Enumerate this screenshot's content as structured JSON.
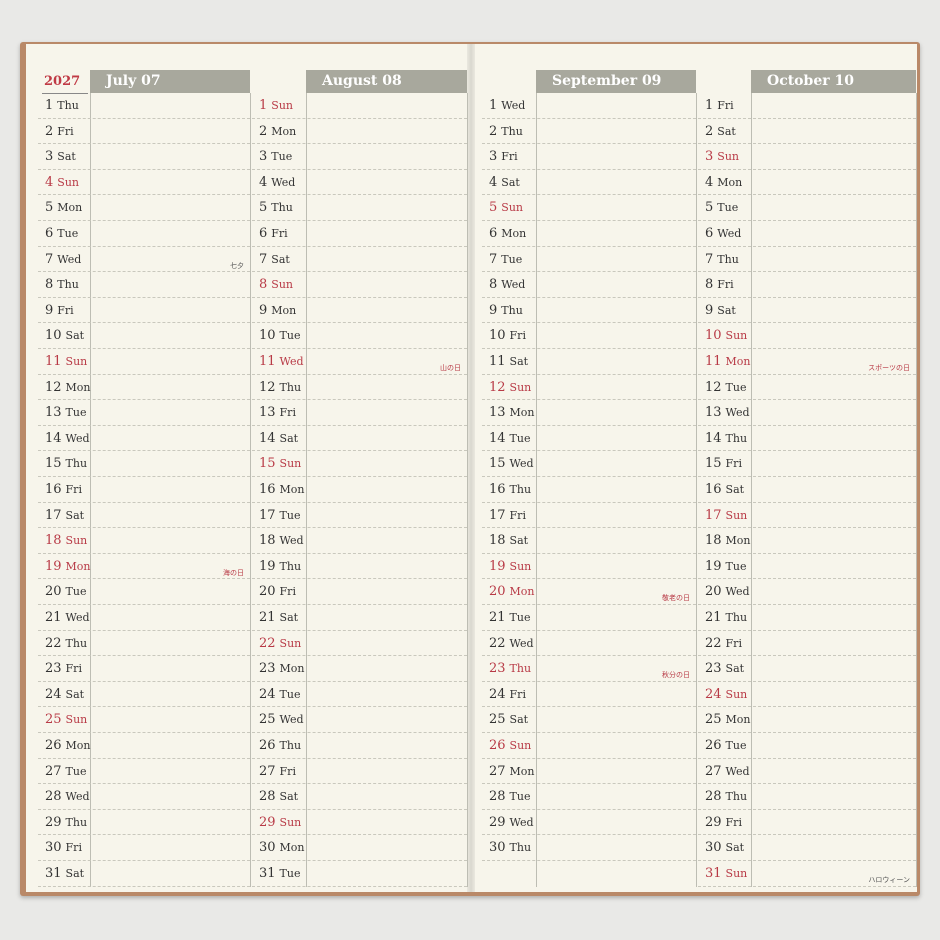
{
  "year": "2027",
  "columns": [
    {
      "month_label": "July 07",
      "days": [
        {
          "n": "1",
          "w": "Thu"
        },
        {
          "n": "2",
          "w": "Fri"
        },
        {
          "n": "3",
          "w": "Sat"
        },
        {
          "n": "4",
          "w": "Sun",
          "red": true
        },
        {
          "n": "5",
          "w": "Mon"
        },
        {
          "n": "6",
          "w": "Tue"
        },
        {
          "n": "7",
          "w": "Wed",
          "hol": "七夕",
          "hol_black": true
        },
        {
          "n": "8",
          "w": "Thu"
        },
        {
          "n": "9",
          "w": "Fri"
        },
        {
          "n": "10",
          "w": "Sat"
        },
        {
          "n": "11",
          "w": "Sun",
          "red": true
        },
        {
          "n": "12",
          "w": "Mon"
        },
        {
          "n": "13",
          "w": "Tue"
        },
        {
          "n": "14",
          "w": "Wed"
        },
        {
          "n": "15",
          "w": "Thu"
        },
        {
          "n": "16",
          "w": "Fri"
        },
        {
          "n": "17",
          "w": "Sat"
        },
        {
          "n": "18",
          "w": "Sun",
          "red": true
        },
        {
          "n": "19",
          "w": "Mon",
          "red": true,
          "hol": "海の日"
        },
        {
          "n": "20",
          "w": "Tue"
        },
        {
          "n": "21",
          "w": "Wed"
        },
        {
          "n": "22",
          "w": "Thu"
        },
        {
          "n": "23",
          "w": "Fri"
        },
        {
          "n": "24",
          "w": "Sat"
        },
        {
          "n": "25",
          "w": "Sun",
          "red": true
        },
        {
          "n": "26",
          "w": "Mon"
        },
        {
          "n": "27",
          "w": "Tue"
        },
        {
          "n": "28",
          "w": "Wed"
        },
        {
          "n": "29",
          "w": "Thu"
        },
        {
          "n": "30",
          "w": "Fri"
        },
        {
          "n": "31",
          "w": "Sat"
        }
      ]
    },
    {
      "month_label": "August 08",
      "days": [
        {
          "n": "1",
          "w": "Sun",
          "red": true
        },
        {
          "n": "2",
          "w": "Mon"
        },
        {
          "n": "3",
          "w": "Tue"
        },
        {
          "n": "4",
          "w": "Wed"
        },
        {
          "n": "5",
          "w": "Thu"
        },
        {
          "n": "6",
          "w": "Fri"
        },
        {
          "n": "7",
          "w": "Sat"
        },
        {
          "n": "8",
          "w": "Sun",
          "red": true
        },
        {
          "n": "9",
          "w": "Mon"
        },
        {
          "n": "10",
          "w": "Tue"
        },
        {
          "n": "11",
          "w": "Wed",
          "red": true,
          "hol": "山の日"
        },
        {
          "n": "12",
          "w": "Thu"
        },
        {
          "n": "13",
          "w": "Fri"
        },
        {
          "n": "14",
          "w": "Sat"
        },
        {
          "n": "15",
          "w": "Sun",
          "red": true
        },
        {
          "n": "16",
          "w": "Mon"
        },
        {
          "n": "17",
          "w": "Tue"
        },
        {
          "n": "18",
          "w": "Wed"
        },
        {
          "n": "19",
          "w": "Thu"
        },
        {
          "n": "20",
          "w": "Fri"
        },
        {
          "n": "21",
          "w": "Sat"
        },
        {
          "n": "22",
          "w": "Sun",
          "red": true
        },
        {
          "n": "23",
          "w": "Mon"
        },
        {
          "n": "24",
          "w": "Tue"
        },
        {
          "n": "25",
          "w": "Wed"
        },
        {
          "n": "26",
          "w": "Thu"
        },
        {
          "n": "27",
          "w": "Fri"
        },
        {
          "n": "28",
          "w": "Sat"
        },
        {
          "n": "29",
          "w": "Sun",
          "red": true
        },
        {
          "n": "30",
          "w": "Mon"
        },
        {
          "n": "31",
          "w": "Tue"
        }
      ]
    },
    {
      "month_label": "September 09",
      "days": [
        {
          "n": "1",
          "w": "Wed"
        },
        {
          "n": "2",
          "w": "Thu"
        },
        {
          "n": "3",
          "w": "Fri"
        },
        {
          "n": "4",
          "w": "Sat"
        },
        {
          "n": "5",
          "w": "Sun",
          "red": true
        },
        {
          "n": "6",
          "w": "Mon"
        },
        {
          "n": "7",
          "w": "Tue"
        },
        {
          "n": "8",
          "w": "Wed"
        },
        {
          "n": "9",
          "w": "Thu"
        },
        {
          "n": "10",
          "w": "Fri"
        },
        {
          "n": "11",
          "w": "Sat"
        },
        {
          "n": "12",
          "w": "Sun",
          "red": true
        },
        {
          "n": "13",
          "w": "Mon"
        },
        {
          "n": "14",
          "w": "Tue"
        },
        {
          "n": "15",
          "w": "Wed"
        },
        {
          "n": "16",
          "w": "Thu"
        },
        {
          "n": "17",
          "w": "Fri"
        },
        {
          "n": "18",
          "w": "Sat"
        },
        {
          "n": "19",
          "w": "Sun",
          "red": true
        },
        {
          "n": "20",
          "w": "Mon",
          "red": true,
          "hol": "敬老の日"
        },
        {
          "n": "21",
          "w": "Tue"
        },
        {
          "n": "22",
          "w": "Wed"
        },
        {
          "n": "23",
          "w": "Thu",
          "red": true,
          "hol": "秋分の日"
        },
        {
          "n": "24",
          "w": "Fri"
        },
        {
          "n": "25",
          "w": "Sat"
        },
        {
          "n": "26",
          "w": "Sun",
          "red": true
        },
        {
          "n": "27",
          "w": "Mon"
        },
        {
          "n": "28",
          "w": "Tue"
        },
        {
          "n": "29",
          "w": "Wed"
        },
        {
          "n": "30",
          "w": "Thu"
        }
      ]
    },
    {
      "month_label": "October 10",
      "days": [
        {
          "n": "1",
          "w": "Fri"
        },
        {
          "n": "2",
          "w": "Sat"
        },
        {
          "n": "3",
          "w": "Sun",
          "red": true
        },
        {
          "n": "4",
          "w": "Mon"
        },
        {
          "n": "5",
          "w": "Tue"
        },
        {
          "n": "6",
          "w": "Wed"
        },
        {
          "n": "7",
          "w": "Thu"
        },
        {
          "n": "8",
          "w": "Fri"
        },
        {
          "n": "9",
          "w": "Sat"
        },
        {
          "n": "10",
          "w": "Sun",
          "red": true
        },
        {
          "n": "11",
          "w": "Mon",
          "red": true,
          "hol": "スポーツの日"
        },
        {
          "n": "12",
          "w": "Tue"
        },
        {
          "n": "13",
          "w": "Wed"
        },
        {
          "n": "14",
          "w": "Thu"
        },
        {
          "n": "15",
          "w": "Fri"
        },
        {
          "n": "16",
          "w": "Sat"
        },
        {
          "n": "17",
          "w": "Sun",
          "red": true
        },
        {
          "n": "18",
          "w": "Mon"
        },
        {
          "n": "19",
          "w": "Tue"
        },
        {
          "n": "20",
          "w": "Wed"
        },
        {
          "n": "21",
          "w": "Thu"
        },
        {
          "n": "22",
          "w": "Fri"
        },
        {
          "n": "23",
          "w": "Sat"
        },
        {
          "n": "24",
          "w": "Sun",
          "red": true
        },
        {
          "n": "25",
          "w": "Mon"
        },
        {
          "n": "26",
          "w": "Tue"
        },
        {
          "n": "27",
          "w": "Wed"
        },
        {
          "n": "28",
          "w": "Thu"
        },
        {
          "n": "29",
          "w": "Fri"
        },
        {
          "n": "30",
          "w": "Sat"
        },
        {
          "n": "31",
          "w": "Sun",
          "red": true,
          "hol": "ハロウィーン",
          "hol_black": true
        }
      ]
    }
  ],
  "colors": {
    "sunday_red": "#b83a46",
    "header_gray": "#a8a89d",
    "paper": "#f7f5eb",
    "cover": "#b98968"
  }
}
